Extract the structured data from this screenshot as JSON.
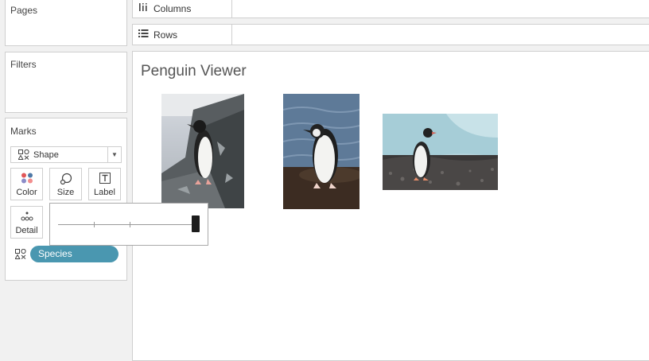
{
  "left_panel": {
    "pages_title": "Pages",
    "filters_title": "Filters",
    "marks": {
      "title": "Marks",
      "mark_type": "Shape",
      "buttons": {
        "color": "Color",
        "size": "Size",
        "label": "Label",
        "detail": "Detail"
      },
      "size_slider": {
        "level": 1.0
      },
      "pill": {
        "label": "Species",
        "color": "#4a97b0",
        "icon": "shape-icon"
      }
    }
  },
  "shelves": {
    "columns": {
      "label": "Columns",
      "icon": "columns-icon"
    },
    "rows": {
      "label": "Rows",
      "icon": "rows-icon"
    }
  },
  "view": {
    "title": "Penguin Viewer",
    "images": [
      {
        "name": "penguin-image-1",
        "description": "penguin-on-rock"
      },
      {
        "name": "penguin-image-2",
        "description": "penguin-at-water"
      },
      {
        "name": "penguin-image-3",
        "description": "penguin-on-pebbles"
      }
    ]
  }
}
